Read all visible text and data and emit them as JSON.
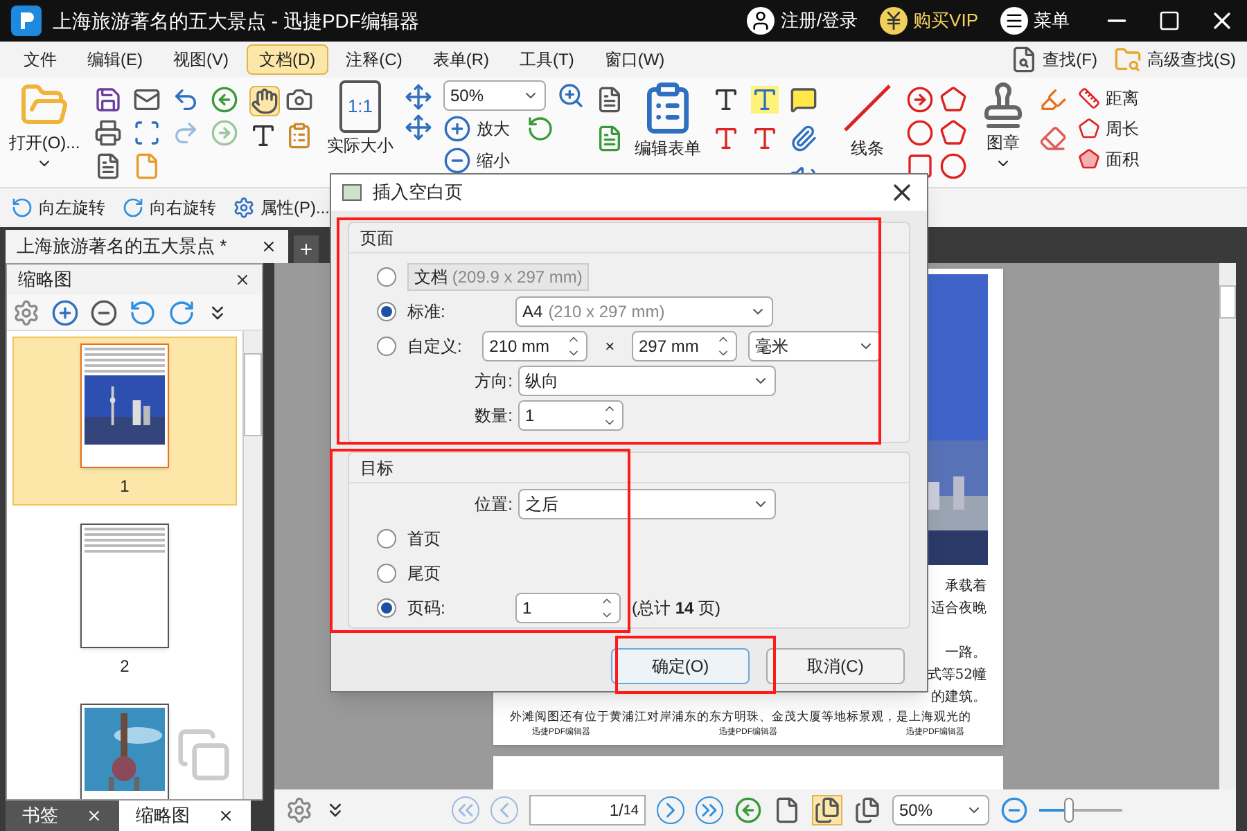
{
  "window": {
    "title": "上海旅游著名的五大景点 - 迅捷PDF编辑器",
    "account": "注册/登录",
    "vip": "购买VIP",
    "menu": "菜单"
  },
  "menu_bar": {
    "items": [
      {
        "label": "文件",
        "selected": false
      },
      {
        "label": "编辑(E)",
        "selected": false
      },
      {
        "label": "视图(V)",
        "selected": false
      },
      {
        "label": "文档(D)",
        "selected": true
      },
      {
        "label": "注释(C)",
        "selected": false
      },
      {
        "label": "表单(R)",
        "selected": false
      },
      {
        "label": "工具(T)",
        "selected": false
      },
      {
        "label": "窗口(W)",
        "selected": false
      }
    ],
    "search": "查找(F)",
    "advanced_search": "高级查找(S)"
  },
  "ribbon": {
    "open": "打开(O)...",
    "actual_size": "实际大小",
    "actual_size_icon": "1:1",
    "zoom": "50%",
    "zoom_in": "放大",
    "zoom_out": "缩小",
    "edit_form": "编辑表单",
    "lines": "线条",
    "stamp": "图章",
    "distance": "距离",
    "perimeter": "周长",
    "area": "面积"
  },
  "toolbar": [
    "向左旋转",
    "向右旋转",
    "属性(P)..."
  ],
  "document_tabs": [
    {
      "label": "上海旅游著名的五大景点 *",
      "selected": true
    }
  ],
  "thumbnail_panel": {
    "title": "缩略图",
    "pages": [
      {
        "label": "1",
        "selected": true,
        "kind": "skyline"
      },
      {
        "label": "2",
        "selected": false,
        "kind": "text"
      },
      {
        "selected": false,
        "kind": "tower"
      }
    ]
  },
  "panel_tabs": [
    {
      "label": "书签",
      "selected": false
    },
    {
      "label": "缩略图",
      "selected": true
    }
  ],
  "page_view": {
    "fragments": [
      "承载着",
      "适合夜晚",
      "一路。",
      "式等52幢",
      "的建筑。"
    ],
    "line": "外滩阅图还有位于黄浦江对岸浦东的东方明珠、金茂大厦等地标景观，是上海观光的",
    "footers": [
      "迅捷PDF编辑器",
      "迅捷PDF编辑器",
      "迅捷PDF编辑器"
    ]
  },
  "navigation": {
    "page": "1",
    "separator": "/",
    "total": "14",
    "zoom": "50%",
    "zoom_slider": {
      "level": 0.35
    }
  },
  "dialog": {
    "title": "插入空白页",
    "page_group": {
      "title": "页面",
      "document": {
        "label": "文档",
        "size": "(209.9 x 297 mm)",
        "selected": false
      },
      "standard": {
        "label": "标准:",
        "value": "A4",
        "hint": "(210 x 297 mm)",
        "selected": true
      },
      "custom": {
        "label": "自定义:",
        "width": "210 mm",
        "times": "×",
        "height": "297 mm",
        "unit": "毫米",
        "selected": false
      },
      "orientation": {
        "label": "方向:",
        "value": "纵向"
      },
      "count": {
        "label": "数量:",
        "value": "1"
      }
    },
    "target_group": {
      "title": "目标",
      "position": {
        "label": "位置:",
        "value": "之后"
      },
      "first": {
        "label": "首页",
        "selected": false
      },
      "last": {
        "label": "尾页",
        "selected": false
      },
      "page_number": {
        "label": "页码:",
        "value": "1",
        "selected": true
      },
      "total_prefix": "(总计",
      "total_count": "14",
      "total_suffix": "页)"
    },
    "ok": "确定(O)",
    "cancel": "取消(C)"
  }
}
